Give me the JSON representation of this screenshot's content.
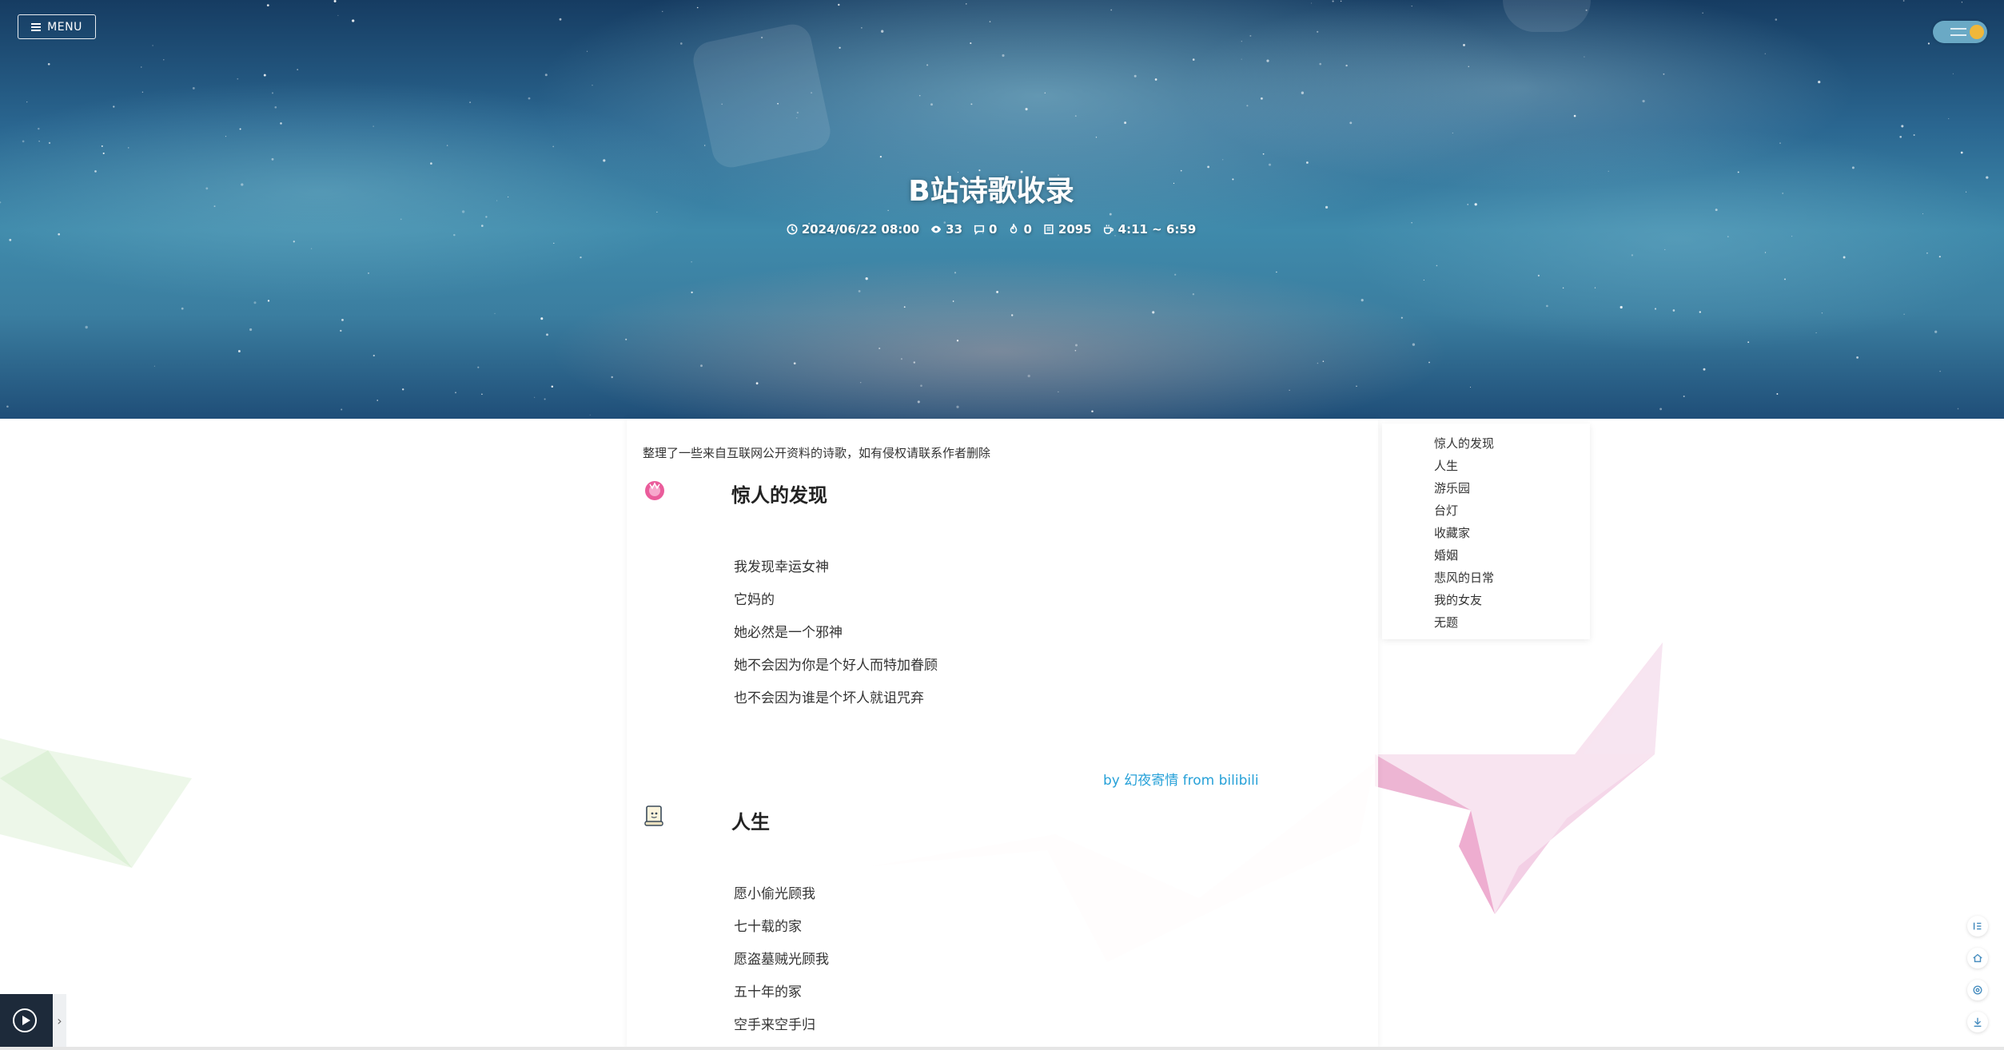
{
  "header": {
    "menu_label": "MENU",
    "title": "B站诗歌收录",
    "meta": {
      "date": "2024/06/22 08:00",
      "views": "33",
      "comments": "0",
      "likes": "0",
      "words": "2095",
      "reading_time": "4:11 ~ 6:59"
    }
  },
  "article": {
    "intro": "整理了一些来自互联网公开资料的诗歌，如有侵权请联系作者删除",
    "sections": [
      {
        "title": "惊人的发现",
        "icon": "pink-flower-icon",
        "lines": [
          "我发现幸运女神",
          "它妈的",
          "她必然是一个邪神",
          "她不会因为你是个好人而特加眷顾",
          "也不会因为谁是个坏人就诅咒弃"
        ],
        "byline": "by 幻夜寄情 from bilibili"
      },
      {
        "title": "人生",
        "icon": "scroll-icon",
        "lines": [
          "愿小偷光顾我",
          "七十载的家",
          "愿盗墓贼光顾我",
          "五十年的冢",
          "空手来空手归"
        ]
      }
    ]
  },
  "toc": {
    "items": [
      "惊人的发现",
      "人生",
      "游乐园",
      "台灯",
      "收藏家",
      "婚姻",
      "悲风的日常",
      "我的女友",
      "无题"
    ]
  },
  "colors": {
    "link": "#27a1d8",
    "toggle_knob": "#f0b73a",
    "toggle_track": "#6aa9c5"
  },
  "player": {
    "expand_glyph": "›"
  }
}
